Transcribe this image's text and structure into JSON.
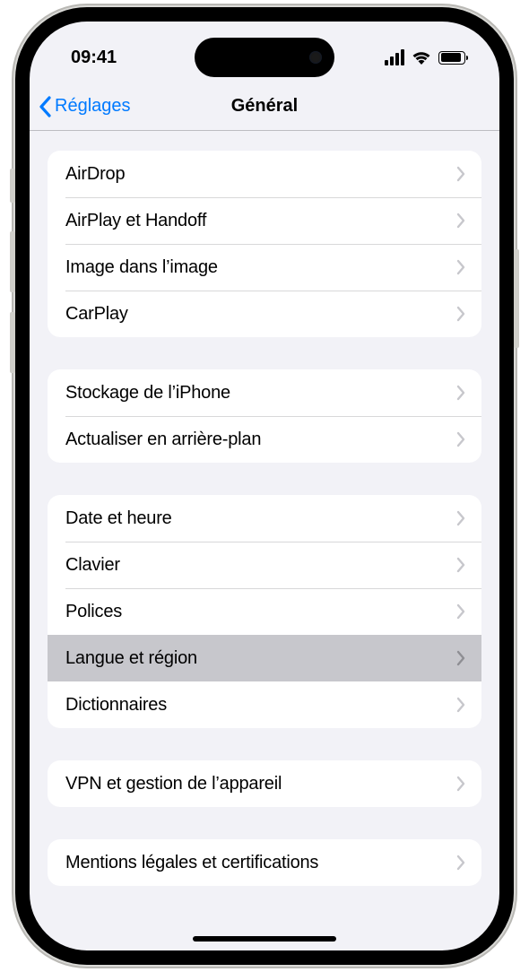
{
  "status": {
    "time": "09:41"
  },
  "nav": {
    "back": "Réglages",
    "title": "Général"
  },
  "groups": [
    {
      "rows": [
        {
          "id": "airdrop",
          "label": "AirDrop",
          "highlighted": false
        },
        {
          "id": "airplay-handoff",
          "label": "AirPlay et Handoff",
          "highlighted": false
        },
        {
          "id": "picture-in-picture",
          "label": "Image dans l’image",
          "highlighted": false
        },
        {
          "id": "carplay",
          "label": "CarPlay",
          "highlighted": false
        }
      ]
    },
    {
      "rows": [
        {
          "id": "iphone-storage",
          "label": "Stockage de l’iPhone",
          "highlighted": false
        },
        {
          "id": "background-refresh",
          "label": "Actualiser en arrière-plan",
          "highlighted": false
        }
      ]
    },
    {
      "rows": [
        {
          "id": "date-time",
          "label": "Date et heure",
          "highlighted": false
        },
        {
          "id": "keyboard",
          "label": "Clavier",
          "highlighted": false
        },
        {
          "id": "fonts",
          "label": "Polices",
          "highlighted": false
        },
        {
          "id": "language-region",
          "label": "Langue et région",
          "highlighted": true
        },
        {
          "id": "dictionaries",
          "label": "Dictionnaires",
          "highlighted": false
        }
      ]
    },
    {
      "rows": [
        {
          "id": "vpn-device-management",
          "label": "VPN et gestion de l’appareil",
          "highlighted": false
        }
      ]
    },
    {
      "rows": [
        {
          "id": "legal-certifications",
          "label": "Mentions légales et certifications",
          "highlighted": false
        }
      ]
    }
  ]
}
